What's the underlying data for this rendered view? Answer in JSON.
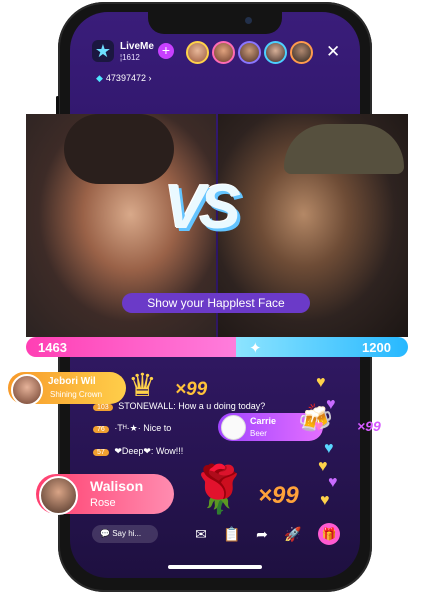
{
  "header": {
    "app_name": "LiveMe",
    "fans_count": "¦1612",
    "coins": "47397472 ›"
  },
  "stream": {
    "challenge_banner": "Show your Happlest Face",
    "vs_label": "VS"
  },
  "score": {
    "left": "1463",
    "right": "1200",
    "left_value": 1463,
    "right_value": 1200
  },
  "gifts": {
    "top": {
      "name": "Jebori Wil",
      "gift": "Shining Crown",
      "multiplier": "×99"
    },
    "mid": {
      "name": "Carrie",
      "gift": "Beer",
      "multiplier": "×99"
    },
    "big": {
      "name": "Walison",
      "gift": "Rose",
      "multiplier": "×99"
    }
  },
  "chat": [
    {
      "level": "103",
      "user": "STONEWALL:",
      "message": "How a u doing today?"
    },
    {
      "level": "76",
      "user": "·Tᴴ·★·",
      "message": "Nice to"
    },
    {
      "level": "57",
      "user": "❤Deep❤:",
      "message": "Wow!!!"
    },
    {
      "level": "",
      "user": "",
      "message": ""
    }
  ],
  "bottom": {
    "say_hi": "Say hi..."
  },
  "colors": {
    "accent": "#c840ff",
    "score_left": "#ff3fb4",
    "score_right": "#27b8ff",
    "gold": "#ffc23a"
  }
}
